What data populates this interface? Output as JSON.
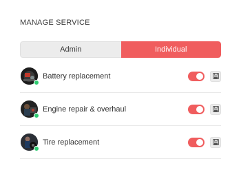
{
  "header": {
    "title": "MANAGE SERVICE"
  },
  "tabs": [
    {
      "label": "Admin",
      "active": false
    },
    {
      "label": "Individual",
      "active": true
    }
  ],
  "services": [
    {
      "label": "Battery replacement",
      "enabled": true,
      "online": true,
      "avatar": "car-engine-photo"
    },
    {
      "label": "Engine repair & overhaul",
      "enabled": true,
      "online": true,
      "avatar": "mechanic-photo"
    },
    {
      "label": "Tire replacement",
      "enabled": true,
      "online": true,
      "avatar": "tire-photo"
    }
  ],
  "colors": {
    "accent": "#f05d5e",
    "online": "#2ecc71",
    "tab_inactive_bg": "#ececec",
    "divider": "#e9e9e9"
  },
  "icons": {
    "save": "floppy-disk-icon"
  }
}
